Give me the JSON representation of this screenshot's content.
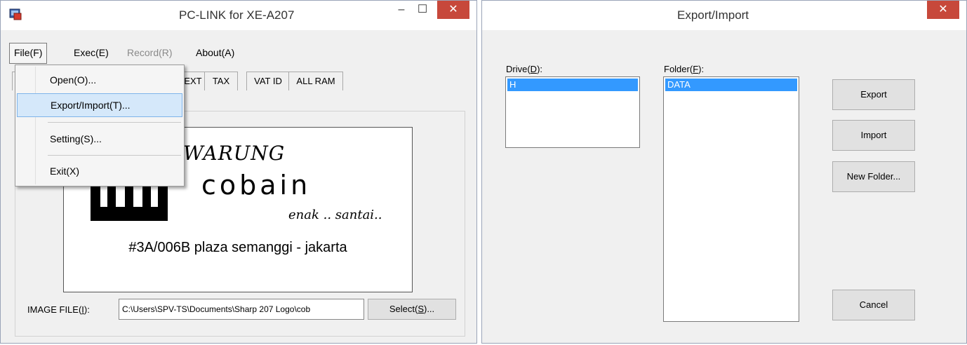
{
  "colors": {
    "close_red": "#c7483b",
    "selection_blue": "#3399ff",
    "highlight_menu": "#d5e8fa"
  },
  "main_window": {
    "title": "PC-LINK for XE-A207",
    "minimize_glyph": "–",
    "maximize_glyph": "☐",
    "close_glyph": "✕",
    "menu": {
      "file": "File(F)",
      "exec": "Exec(E)",
      "record": "Record(R)",
      "about": "About(A)"
    },
    "tabs": [
      "EXT",
      "TAX",
      "VAT ID",
      "ALL RAM"
    ],
    "file_menu": {
      "open": "Open(O)...",
      "export_import": "Export/Import(T)...",
      "setting": "Setting(S)...",
      "exit": "Exit(X)"
    },
    "logo": {
      "line1": "WARUNG",
      "line2": "cobain",
      "line3": "enak .. santai..",
      "address": "#3A/006B plaza semanggi - jakarta"
    },
    "image_file": {
      "label_pre": "IMAGE FILE(",
      "label_key": "I",
      "label_post": "):",
      "path": "C:\\Users\\SPV-TS\\Documents\\Sharp 207 Logo\\cob",
      "select_pre": "Select(",
      "select_key": "S",
      "select_post": ")..."
    }
  },
  "export_dialog": {
    "title": "Export/Import",
    "close_glyph": "✕",
    "drive": {
      "label_pre": "Drive(",
      "label_key": "D",
      "label_post": "):",
      "items": [
        "H"
      ]
    },
    "folder": {
      "label_pre": "Folder(",
      "label_key": "F",
      "label_post": "):",
      "items": [
        "DATA"
      ]
    },
    "buttons": {
      "export": "Export",
      "import": "Import",
      "new_folder": "New Folder...",
      "cancel": "Cancel"
    }
  }
}
